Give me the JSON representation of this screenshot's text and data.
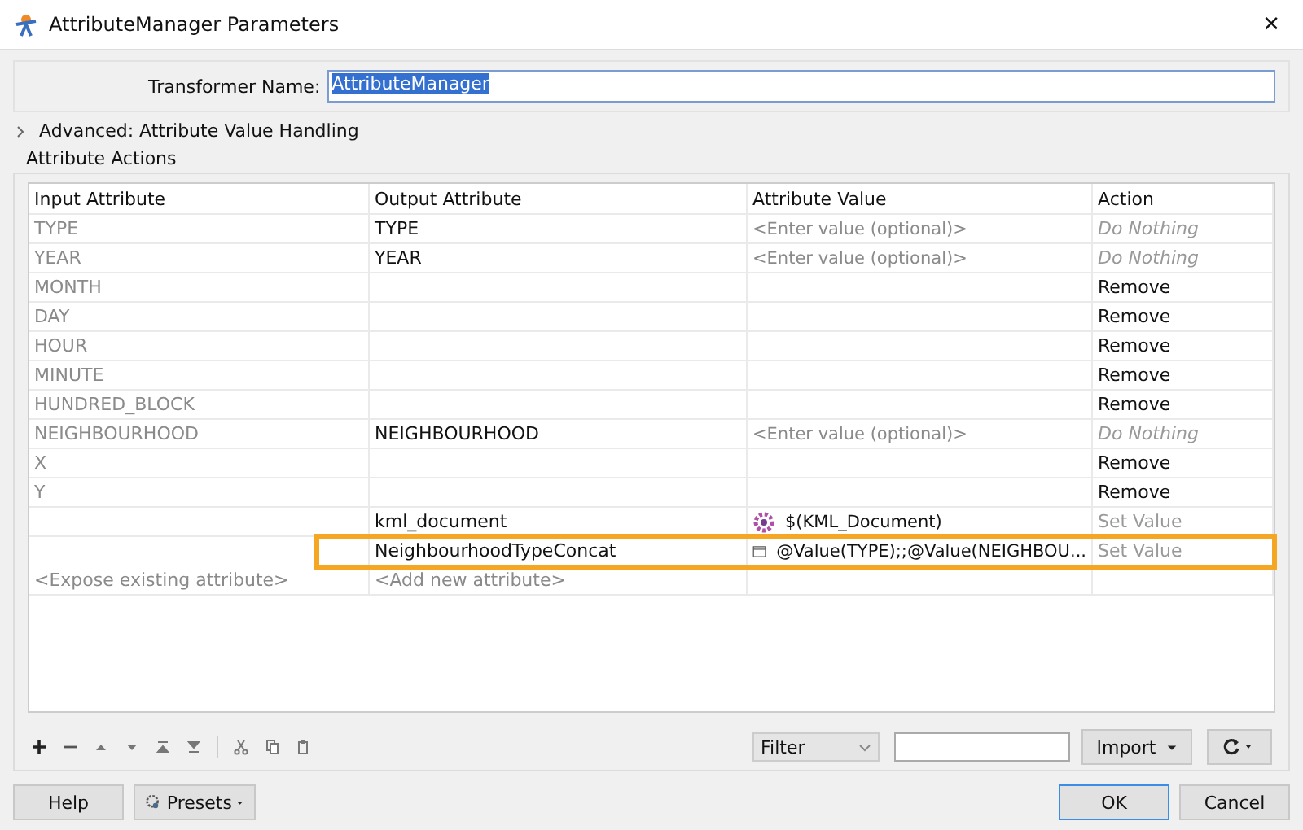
{
  "window": {
    "title": "AttributeManager Parameters",
    "close": "✕"
  },
  "transformer_name": {
    "label": "Transformer Name:",
    "value": "AttributeManager"
  },
  "advanced": {
    "label": "Advanced: Attribute Value Handling",
    "expanded": false
  },
  "group_title": "Attribute Actions",
  "table": {
    "columns": [
      "Input Attribute",
      "Output Attribute",
      "Attribute Value",
      "Action"
    ],
    "rows": [
      {
        "input": "TYPE",
        "output": "TYPE",
        "value": {
          "text": "<Enter value (optional)>",
          "kind": "placeholder"
        },
        "action": {
          "text": "Do Nothing",
          "kind": "none"
        },
        "highlighted": false
      },
      {
        "input": "YEAR",
        "output": "YEAR",
        "value": {
          "text": "<Enter value (optional)>",
          "kind": "placeholder"
        },
        "action": {
          "text": "Do Nothing",
          "kind": "none"
        },
        "highlighted": false
      },
      {
        "input": "MONTH",
        "action": {
          "text": "Remove",
          "kind": "remove"
        },
        "highlighted": false
      },
      {
        "input": "DAY",
        "action": {
          "text": "Remove",
          "kind": "remove"
        },
        "highlighted": false
      },
      {
        "input": "HOUR",
        "action": {
          "text": "Remove",
          "kind": "remove"
        },
        "highlighted": false
      },
      {
        "input": "MINUTE",
        "action": {
          "text": "Remove",
          "kind": "remove"
        },
        "highlighted": false
      },
      {
        "input": "HUNDRED_BLOCK",
        "action": {
          "text": "Remove",
          "kind": "remove"
        },
        "highlighted": false
      },
      {
        "input": "NEIGHBOURHOOD",
        "output": "NEIGHBOURHOOD",
        "value": {
          "text": "<Enter value (optional)>",
          "kind": "placeholder"
        },
        "action": {
          "text": "Do Nothing",
          "kind": "none"
        },
        "highlighted": false
      },
      {
        "input": "X",
        "action": {
          "text": "Remove",
          "kind": "remove"
        },
        "highlighted": false
      },
      {
        "input": "Y",
        "action": {
          "text": "Remove",
          "kind": "remove"
        },
        "highlighted": false
      },
      {
        "output": "kml_document",
        "value": {
          "text": "$(KML_Document)",
          "kind": "parameter"
        },
        "action": {
          "text": "Set Value",
          "kind": "set"
        },
        "highlighted": false
      },
      {
        "output": "NeighbourhoodTypeConcat",
        "value": {
          "text": "@Value(TYPE);;@Value(NEIGHBOU...",
          "kind": "expression"
        },
        "action": {
          "text": "Set Value",
          "kind": "set"
        },
        "highlighted": true
      }
    ],
    "add_row": {
      "input": "<Expose existing attribute>",
      "output": "<Add new attribute>"
    }
  },
  "filter": {
    "value": "Filter"
  },
  "import_button": "Import",
  "buttons": {
    "help": "Help",
    "presets": "Presets",
    "ok": "OK",
    "cancel": "Cancel"
  }
}
